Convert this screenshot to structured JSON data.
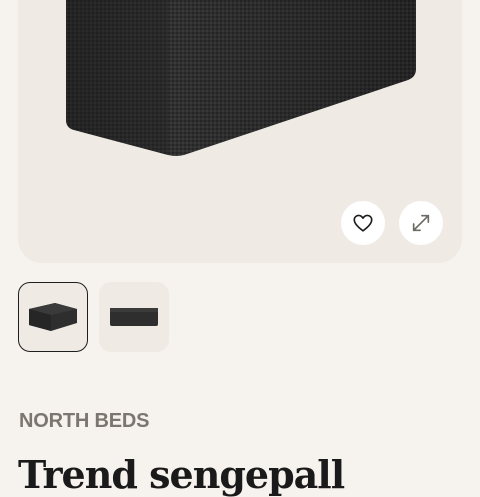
{
  "product": {
    "brand": "NORTH BEDS",
    "title": "Trend sengepall"
  },
  "gallery": {
    "thumbnails": [
      {
        "label": "Bench front view",
        "selected": true
      },
      {
        "label": "Bench low view",
        "selected": false
      }
    ]
  },
  "actions": {
    "favorite_icon": "heart-icon",
    "expand_icon": "expand-icon"
  },
  "colors": {
    "page_bg": "#f6f2ee",
    "gallery_bg": "#efebe4",
    "product_fabric": "#2f2f2f",
    "brand_text": "#7b7770",
    "title_text": "#1a1a1a"
  }
}
